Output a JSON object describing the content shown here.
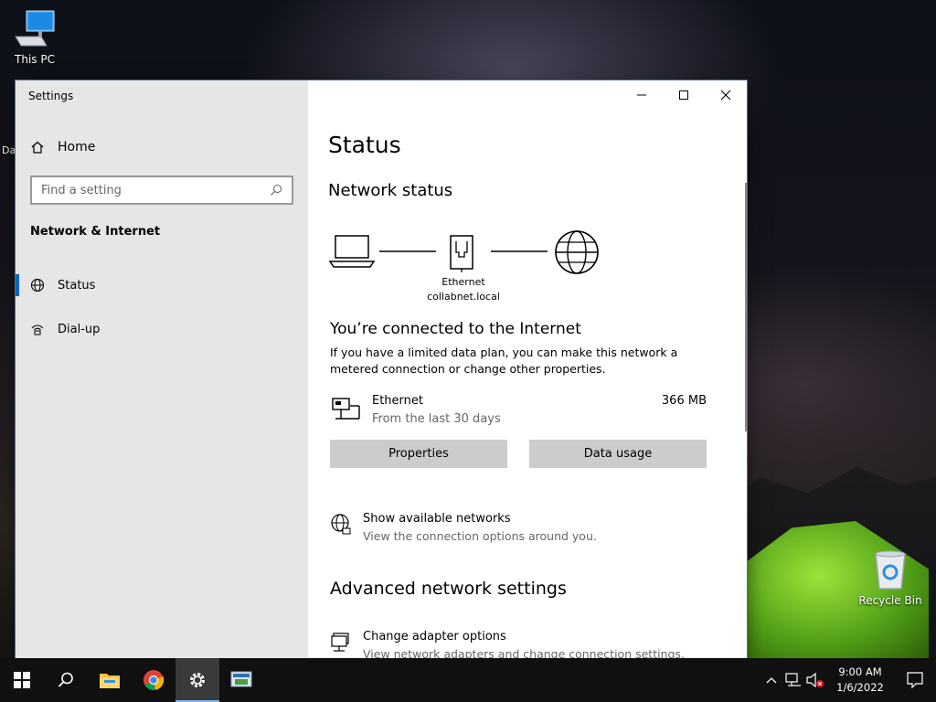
{
  "desktop": {
    "this_pc_label": "This PC",
    "recycle_bin_label": "Recycle Bin",
    "left_fragment": "Da"
  },
  "window": {
    "title": "Settings",
    "controls": {
      "minimize": "minimize-icon",
      "maximize": "maximize-icon",
      "close": "close-icon"
    }
  },
  "sidebar": {
    "home_label": "Home",
    "search_placeholder": "Find a setting",
    "section_label": "Network & Internet",
    "items": [
      {
        "label": "Status",
        "icon": "globe-icon",
        "active": true
      },
      {
        "label": "Dial-up",
        "icon": "dialup-icon",
        "active": false
      }
    ]
  },
  "content": {
    "title": "Status",
    "network_status_heading": "Network status",
    "diagram": {
      "adapter_name": "Ethernet",
      "domain": "collabnet.local"
    },
    "connected_title": "You’re connected to the Internet",
    "connected_desc": "If you have a limited data plan, you can make this network a metered connection or change other properties.",
    "adapter": {
      "name": "Ethernet",
      "period": "From the last 30 days",
      "usage": "366 MB"
    },
    "buttons": {
      "properties": "Properties",
      "data_usage": "Data usage"
    },
    "show_networks": {
      "title": "Show available networks",
      "subtitle": "View the connection options around you."
    },
    "advanced_heading": "Advanced network settings",
    "change_adapter": {
      "title": "Change adapter options",
      "subtitle": "View network adapters and change connection settings."
    }
  },
  "taskbar": {
    "apps": [
      "start-icon",
      "search-icon",
      "file-explorer-icon",
      "chrome-icon",
      "settings-icon",
      "network-app-icon"
    ],
    "active_app": "settings-icon",
    "clock_time": "9:00 AM",
    "clock_date": "1/6/2022"
  },
  "colors": {
    "accent": "#0067c0",
    "sidebar_bg": "#e6e6e6",
    "button_bg": "#cccccc",
    "taskbar_bg": "#101010"
  }
}
